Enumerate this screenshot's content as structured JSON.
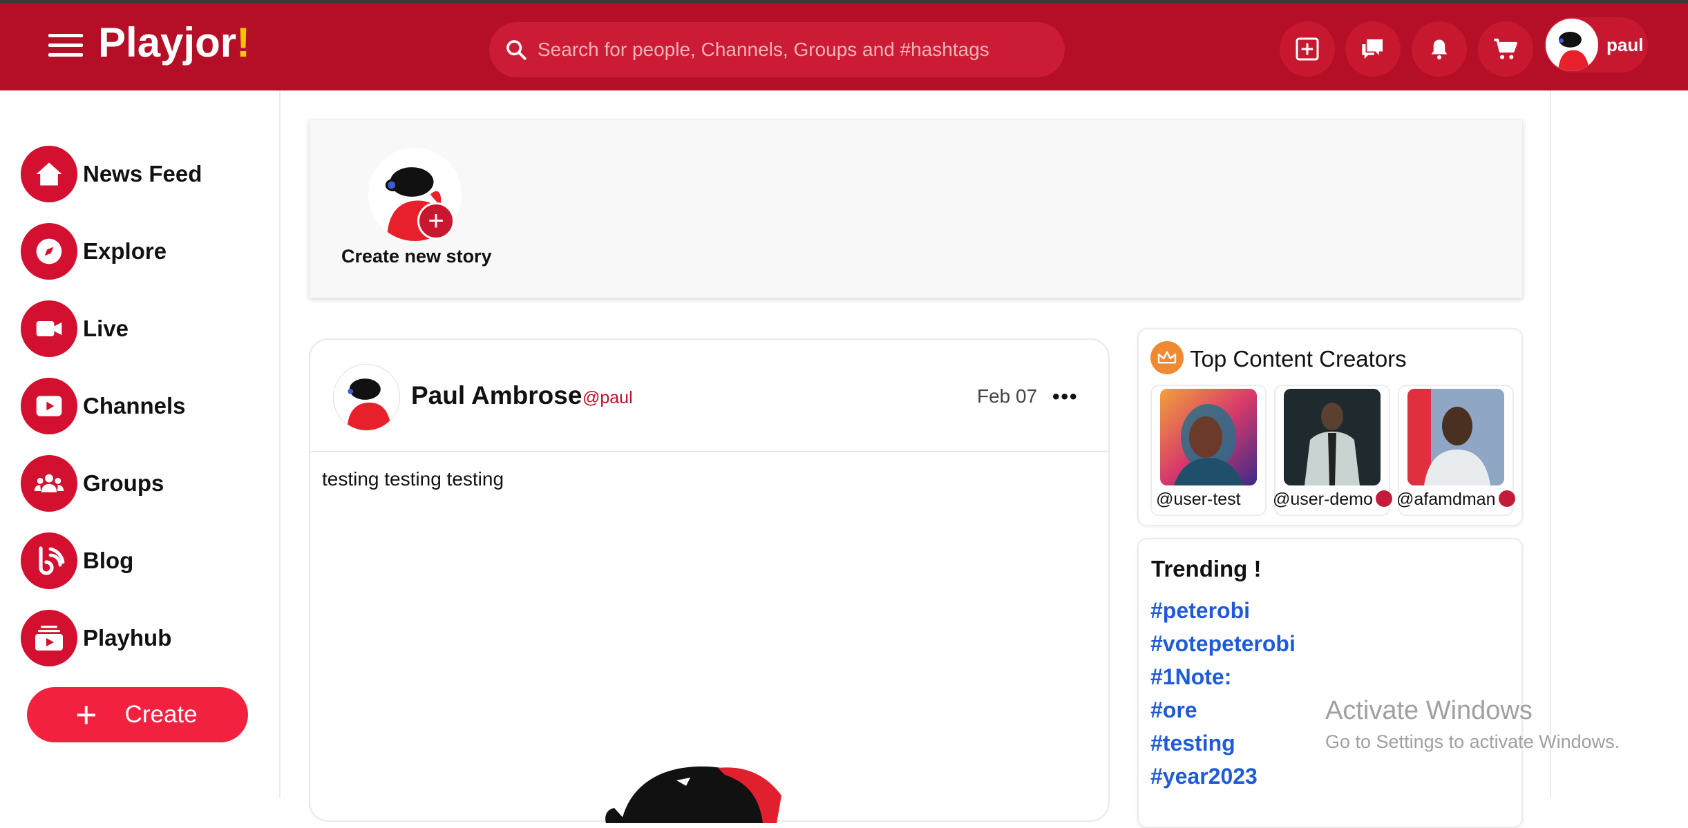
{
  "app": {
    "name": "Playjor",
    "name_mark": "!"
  },
  "header": {
    "search_placeholder": "Search for people, Channels, Groups and #hashtags",
    "user": "paul",
    "icons": [
      "plus-square-icon",
      "chat-icon",
      "bell-icon",
      "cart-icon"
    ]
  },
  "sidebar": {
    "items": [
      {
        "label": "News Feed",
        "icon": "home-icon"
      },
      {
        "label": "Explore",
        "icon": "compass-icon"
      },
      {
        "label": "Live",
        "icon": "video-icon"
      },
      {
        "label": "Channels",
        "icon": "play-icon"
      },
      {
        "label": "Groups",
        "icon": "users-icon"
      },
      {
        "label": "Blog",
        "icon": "blog-icon"
      },
      {
        "label": "Playhub",
        "icon": "playhub-icon"
      }
    ],
    "create_label": "Create"
  },
  "stories": {
    "create_label": "Create new story"
  },
  "post": {
    "author": "Paul Ambrose",
    "handle": "@paul",
    "date": "Feb 07",
    "more": "•••",
    "text": "testing testing testing"
  },
  "creators": {
    "title": "Top Content Creators",
    "items": [
      {
        "handle": "@user-test",
        "verified": false
      },
      {
        "handle": "@user-demo",
        "verified": true
      },
      {
        "handle": "@afamdman",
        "verified": true
      }
    ]
  },
  "trending": {
    "title": "Trending !",
    "tags": [
      "#peterobi",
      "#votepeterobi",
      "#1Note:",
      "#ore",
      "#testing",
      "#year2023"
    ]
  },
  "watermark": {
    "line1": "Activate Windows",
    "line2": "Go to Settings to activate Windows."
  },
  "colors": {
    "brand": "#b50e27",
    "accent": "#f2213f",
    "link": "#1f5bd6"
  }
}
